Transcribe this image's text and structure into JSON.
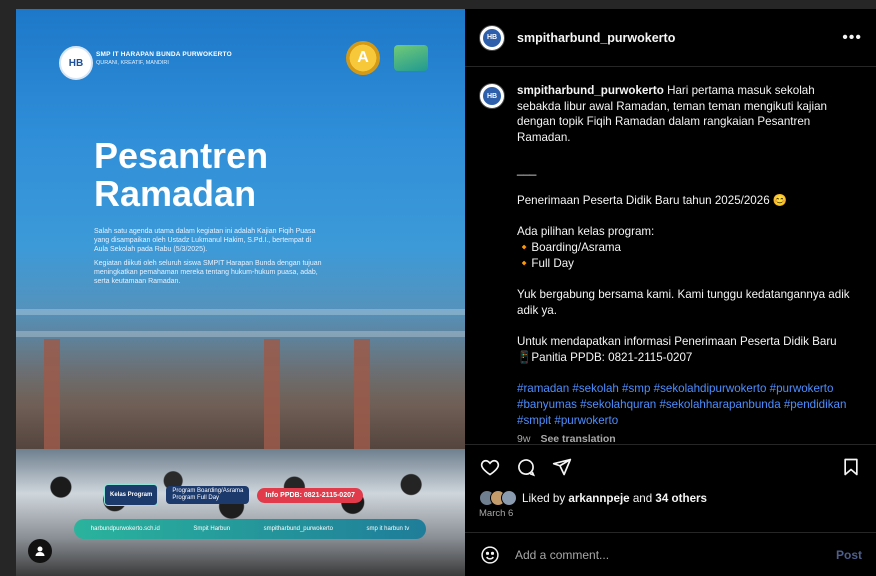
{
  "post_image": {
    "school_name": "SMP IT HARAPAN BUNDA PURWOKERTO",
    "school_tagline": "QURANI, KREATIF, MANDIRI",
    "badge_letter": "A",
    "headline": "Pesantren\nRamadan",
    "paragraph_1": "Salah satu agenda utama dalam kegiatan ini adalah Kajian Fiqih Puasa yang disampaikan oleh Ustadz Lukmanul Hakim, S.Pd.I., bertempat di Aula Sekolah pada Rabu (5/3/2025).",
    "paragraph_2": "Kegiatan diikuti oleh seluruh siswa SMPIT Harapan Bunda dengan tujuan meningkatkan pemahaman mereka tentang hukum-hukum puasa, adab, serta keutamaan Ramadan.",
    "kelas_label": "Kelas Program",
    "program_1": "Program Boarding/Asrama",
    "program_2": "Program Full Day",
    "info_ppdb": "Info PPDB: 0821-2115-0207",
    "contact_web": "harbundpurwokerto.sch.id",
    "contact_fb": "Smpit Harbun",
    "contact_ig": "smpitharbund_purwokerto",
    "contact_yt": "smp it harbun tv"
  },
  "header": {
    "username": "smpitharbund_purwokerto",
    "more_icon": "more-horizontal-icon"
  },
  "caption": {
    "username": "smpitharbund_purwokerto",
    "line_intro": "Hari pertama masuk sekolah sebakda libur awal Ramadan, teman teman mengikuti kajian dengan topik Fiqih Ramadan dalam rangkaian Pesantren Ramadan.",
    "divider": "___",
    "ppdb_line": "Penerimaan Peserta Didik Baru tahun 2025/2026 😊",
    "options_heading": "Ada pilihan kelas program:",
    "option_1": "🔸Boarding/Asrama",
    "option_2": "🔸Full Day",
    "join_line": "Yuk bergabung bersama kami. Kami tunggu kedatangannya adik adik ya.",
    "info_line": "Untuk mendapatkan informasi Penerimaan Peserta Didik Baru",
    "contact_line": "📱Panitia PPDB: 0821-2115-0207",
    "hashtags": "#ramadan #sekolah #smp #sekolahdipurwokerto #purwokerto #banyumas #sekolahquran #sekolahharapanbunda #pendidikan #smpit #purwokerto",
    "age": "9w",
    "see_translation": "See translation"
  },
  "actions": {
    "like_icon": "heart-icon",
    "comment_icon": "comment-icon",
    "share_icon": "send-icon",
    "save_icon": "bookmark-icon"
  },
  "likes": {
    "prefix": "Liked by ",
    "user": "arkannpeje",
    "middle": " and ",
    "others": "34 others"
  },
  "date": "March 6",
  "comment_box": {
    "placeholder": "Add a comment...",
    "post_label": "Post"
  },
  "colors": {
    "background": "#262626",
    "panel": "#000000",
    "link": "#4d8eff",
    "post_disabled": "#4d5f8c"
  }
}
